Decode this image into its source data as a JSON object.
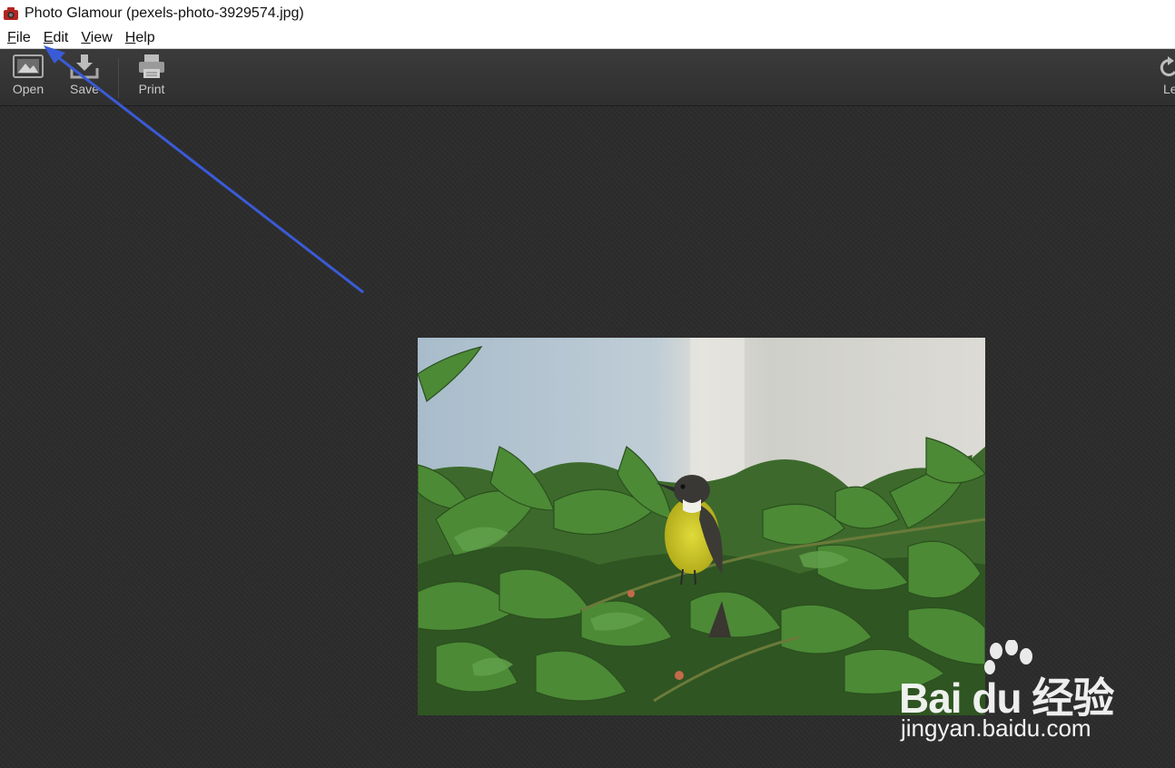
{
  "window": {
    "title": "Photo Glamour (pexels-photo-3929574.jpg)",
    "app_icon": "camera-icon"
  },
  "menubar": {
    "items": [
      {
        "label": "File"
      },
      {
        "label": "Edit"
      },
      {
        "label": "View"
      },
      {
        "label": "Help"
      }
    ]
  },
  "toolbar": {
    "open_label": "Open",
    "save_label": "Save",
    "print_label": "Print",
    "left_label": "Le",
    "icons": {
      "open": "image-icon",
      "save": "download-icon",
      "print": "printer-icon",
      "left": "rotate-left-icon"
    }
  },
  "annotation": {
    "arrow_color": "#3a5bd6",
    "arrow_icon": "arrow-icon"
  },
  "watermark": {
    "brand": "Bai du 经验",
    "url": "jingyan.baidu.com"
  },
  "colors": {
    "workspace": "#2c2c2c",
    "toolbar": "#363636",
    "toolbar_text": "#c9c9c9"
  }
}
